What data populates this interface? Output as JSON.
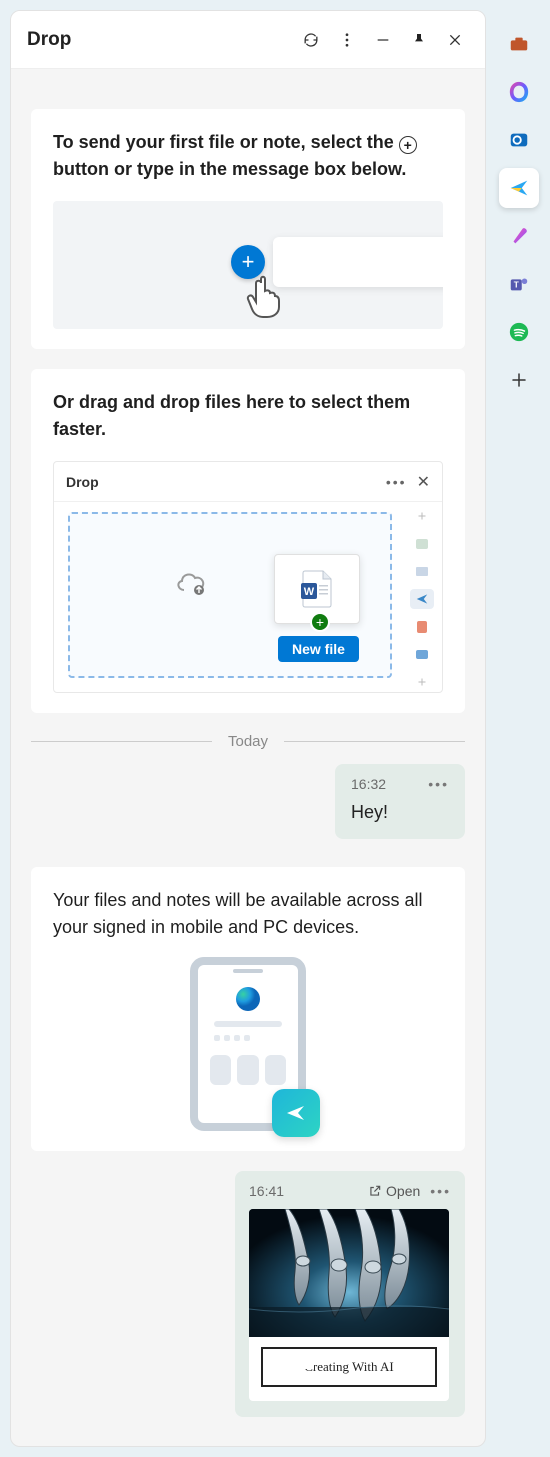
{
  "header": {
    "title": "Drop"
  },
  "cards": {
    "intro1_a": "To send your first file or note, select the",
    "intro1_b": "button or type in the message box below.",
    "intro2": "Or drag and drop files here to select them faster.",
    "intro3": "Your files and notes will be available across all your signed in mobile and PC devices.",
    "illus2_title": "Drop",
    "new_file_label": "New file"
  },
  "divider": "Today",
  "messages": [
    {
      "time": "16:32",
      "text": "Hey!"
    }
  ],
  "attachment": {
    "time": "16:41",
    "open_label": "Open",
    "caption": "Creating With AI"
  }
}
